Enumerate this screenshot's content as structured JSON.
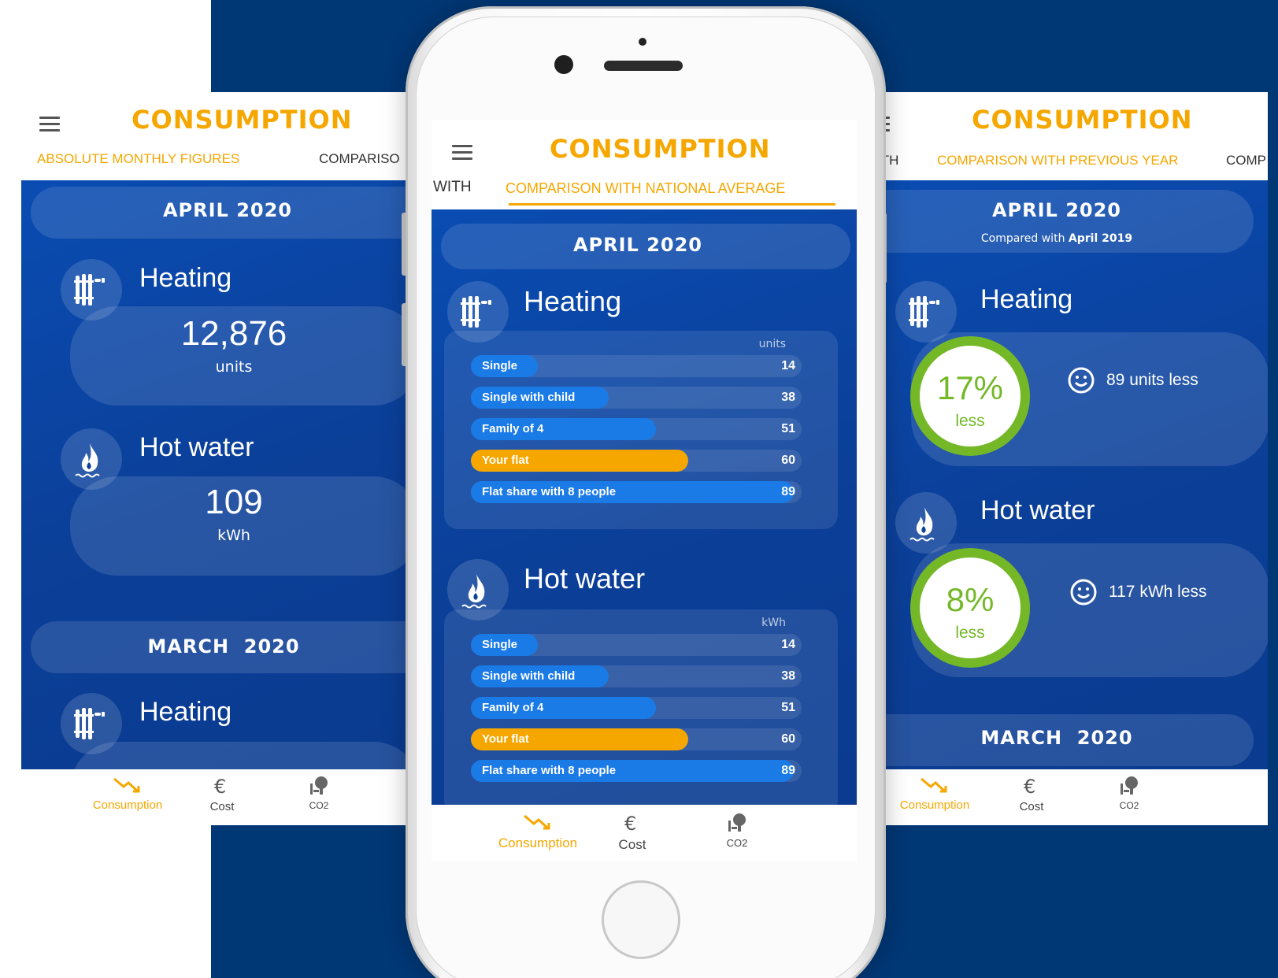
{
  "colors": {
    "brand_orange": "#f5a700",
    "navy_background": "#003775",
    "ring_green": "#74b828",
    "bar_blue": "#1a7ae6"
  },
  "left_screen": {
    "title": "CONSUMPTION",
    "tabs": [
      {
        "label": "ABSOLUTE MONTHLY FIGURES",
        "active": true
      },
      {
        "label": "COMPARISO",
        "active": false
      }
    ],
    "months": [
      {
        "label": "APRIL 2020",
        "items": [
          {
            "icon": "radiator-icon",
            "title": "Heating",
            "value": "12,876",
            "unit": "units"
          },
          {
            "icon": "flame-water-icon",
            "title": "Hot water",
            "value": "109",
            "unit": "kWh"
          }
        ]
      },
      {
        "label": "MARCH  2020",
        "items": [
          {
            "icon": "radiator-icon",
            "title": "Heating",
            "value": "",
            "unit": ""
          }
        ]
      }
    ]
  },
  "center_screen": {
    "title": "CONSUMPTION",
    "tabs": [
      {
        "label": "WITH",
        "active": false
      },
      {
        "label": "COMPARISON WITH NATIONAL AVERAGE",
        "active": true
      }
    ],
    "month_label": "APRIL 2020",
    "sections": [
      {
        "icon": "radiator-icon",
        "title": "Heating",
        "unit": "units",
        "rows": [
          {
            "label": "Single",
            "value": 14,
            "highlight": false
          },
          {
            "label": "Single with child",
            "value": 38,
            "highlight": false
          },
          {
            "label": "Family of 4",
            "value": 51,
            "highlight": false
          },
          {
            "label": "Your flat",
            "value": 60,
            "highlight": true
          },
          {
            "label": "Flat share with 8 people",
            "value": 89,
            "highlight": false
          }
        ]
      },
      {
        "icon": "flame-water-icon",
        "title": "Hot water",
        "unit": "kWh",
        "rows": [
          {
            "label": "Single",
            "value": 14,
            "highlight": false
          },
          {
            "label": "Single with child",
            "value": 38,
            "highlight": false
          },
          {
            "label": "Family of 4",
            "value": 51,
            "highlight": false
          },
          {
            "label": "Your flat",
            "value": 60,
            "highlight": true
          },
          {
            "label": "Flat share with 8 people",
            "value": 89,
            "highlight": false
          }
        ]
      }
    ]
  },
  "right_screen": {
    "title": "CONSUMPTION",
    "tabs": [
      {
        "label": "ITH",
        "active": false
      },
      {
        "label": "COMPARISON WITH PREVIOUS YEAR",
        "active": true
      },
      {
        "label": "COMP",
        "active": false
      }
    ],
    "month_label": "APRIL 2020",
    "compared_prefix": "Compared with ",
    "compared_month": "April 2019",
    "items": [
      {
        "icon": "radiator-icon",
        "title": "Heating",
        "percent": "17%",
        "direction": "less",
        "detail": "89 units less"
      },
      {
        "icon": "flame-water-icon",
        "title": "Hot water",
        "percent": "8%",
        "direction": "less",
        "detail": "117 kWh less"
      }
    ],
    "next_month_label": "MARCH  2020"
  },
  "bottom_nav": [
    {
      "label": "Consumption",
      "icon": "trend-down-icon",
      "active": true
    },
    {
      "label": "Cost",
      "icon": "euro-icon",
      "active": false
    },
    {
      "label": "CO2",
      "icon": "co2-tree-icon",
      "active": false
    }
  ]
}
